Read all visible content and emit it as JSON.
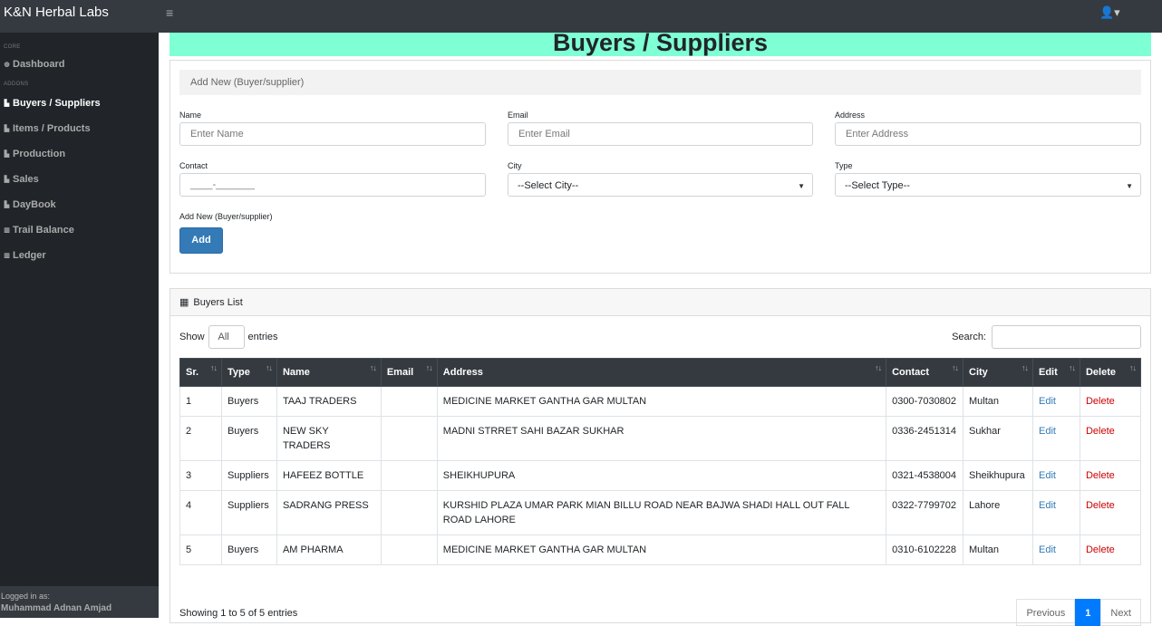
{
  "app": {
    "brand": "K&N Herbal Labs",
    "menu_toggle": "≡",
    "user_icon": "👤▾"
  },
  "sidebar": {
    "heading_core": "CORE",
    "heading_addons": "ADDONS",
    "items": [
      {
        "label": "Dashboard",
        "icon": "dashboard-icon",
        "glyph": "◍"
      },
      {
        "label": "Buyers / Suppliers",
        "icon": "chart-icon",
        "glyph": "▙"
      },
      {
        "label": "Items / Products",
        "icon": "chart-icon",
        "glyph": "▙"
      },
      {
        "label": "Production",
        "icon": "chart-icon",
        "glyph": "▙"
      },
      {
        "label": "Sales",
        "icon": "chart-icon",
        "glyph": "▙"
      },
      {
        "label": "DayBook",
        "icon": "chart-icon",
        "glyph": "▙"
      },
      {
        "label": "Trail Balance",
        "icon": "table-icon",
        "glyph": "▥"
      },
      {
        "label": "Ledger",
        "icon": "table-icon",
        "glyph": "▥"
      }
    ],
    "footer_label": "Logged in as:",
    "footer_user": "Muhammad Adnan Amjad"
  },
  "page": {
    "title": "Buyers / Suppliers"
  },
  "form": {
    "header": "Add New (Buyer/supplier)",
    "name_label": "Name",
    "name_placeholder": "Enter Name",
    "email_label": "Email",
    "email_placeholder": "Enter Email",
    "address_label": "Address",
    "address_placeholder": "Enter Address",
    "contact_label": "Contact",
    "contact_placeholder": "____-_______",
    "city_label": "City",
    "city_value": "--Select City--",
    "type_label": "Type",
    "type_value": "--Select Type--",
    "footer_label": "Add New (Buyer/supplier)",
    "add_button": "Add"
  },
  "list": {
    "header": "Buyers List",
    "show_label": "Show",
    "show_value": "All",
    "entries_label": "entries",
    "search_label": "Search:",
    "columns": [
      "Sr.",
      "Type",
      "Name",
      "Email",
      "Address",
      "Contact",
      "City",
      "Edit",
      "Delete"
    ],
    "rows": [
      {
        "sr": "1",
        "type": "Buyers",
        "name": "TAAJ TRADERS",
        "email": "",
        "address": "MEDICINE MARKET GANTHA GAR MULTAN",
        "contact": "0300-7030802",
        "city": "Multan",
        "edit": "Edit",
        "delete": "Delete"
      },
      {
        "sr": "2",
        "type": "Buyers",
        "name": "NEW SKY TRADERS",
        "email": "",
        "address": "MADNI STRRET SAHI BAZAR SUKHAR",
        "contact": "0336-2451314",
        "city": "Sukhar",
        "edit": "Edit",
        "delete": "Delete"
      },
      {
        "sr": "3",
        "type": "Suppliers",
        "name": "HAFEEZ BOTTLE",
        "email": "",
        "address": "SHEIKHUPURA",
        "contact": "0321-4538004",
        "city": "Sheikhupura",
        "edit": "Edit",
        "delete": "Delete"
      },
      {
        "sr": "4",
        "type": "Suppliers",
        "name": "SADRANG PRESS",
        "email": "",
        "address": "KURSHID PLAZA UMAR PARK MIAN BILLU ROAD NEAR BAJWA SHADI HALL OUT FALL ROAD LAHORE",
        "contact": "0322-7799702",
        "city": "Lahore",
        "edit": "Edit",
        "delete": "Delete"
      },
      {
        "sr": "5",
        "type": "Buyers",
        "name": "AM PHARMA",
        "email": "",
        "address": "MEDICINE MARKET GANTHA GAR MULTAN",
        "contact": "0310-6102228",
        "city": "Multan",
        "edit": "Edit",
        "delete": "Delete"
      }
    ],
    "info": "Showing 1 to 5 of 5 entries",
    "prev": "Previous",
    "page": "1",
    "next": "Next"
  }
}
